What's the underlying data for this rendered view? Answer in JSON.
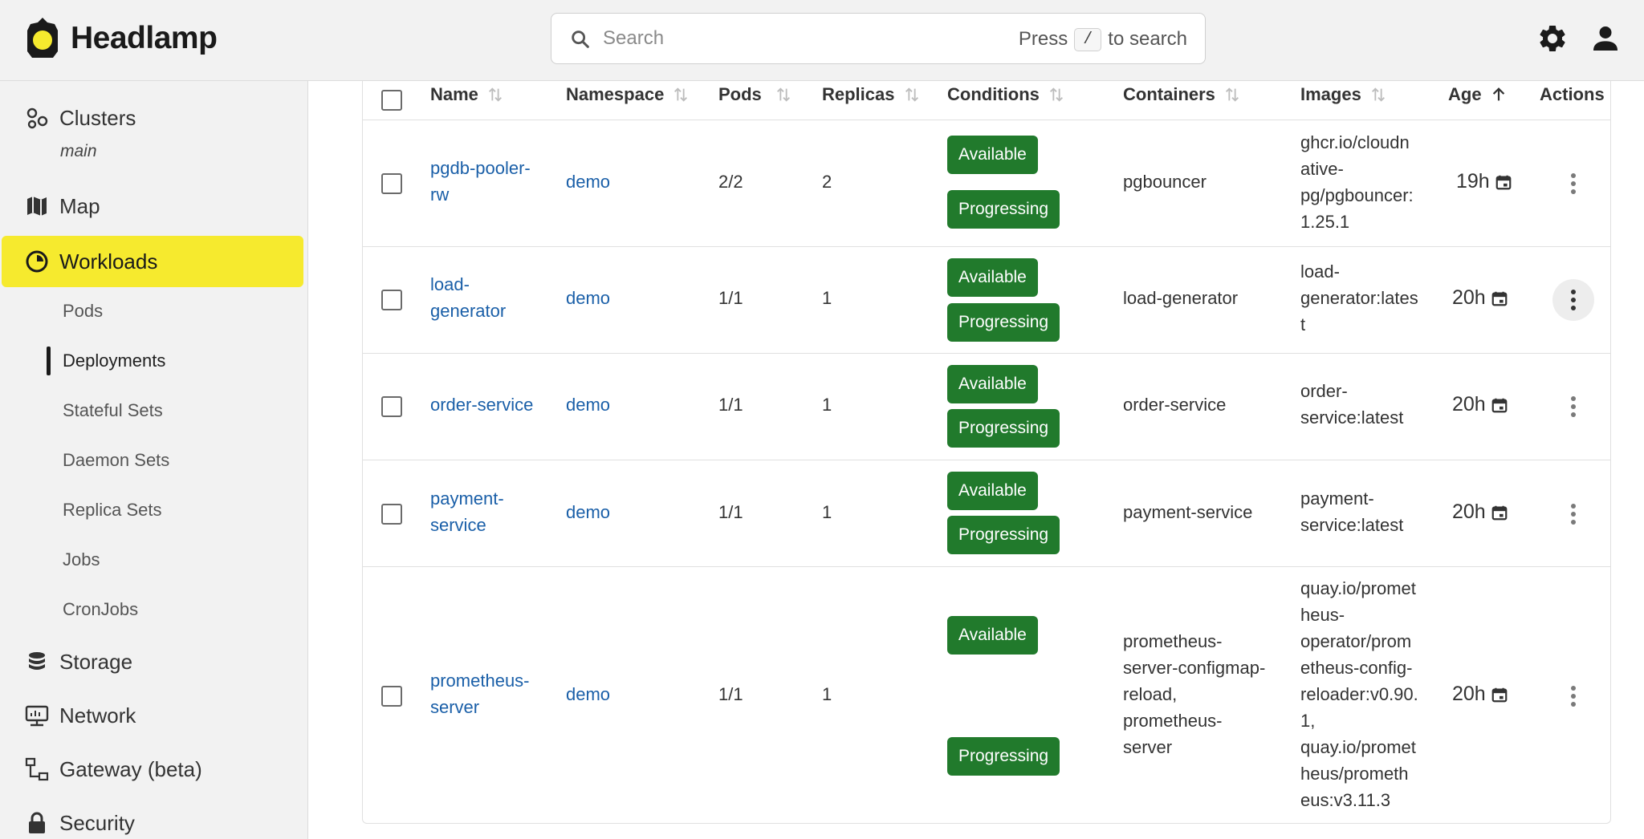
{
  "app": {
    "title": "Headlamp"
  },
  "search": {
    "placeholder": "Search",
    "hint_prefix": "Press",
    "hint_key": "/",
    "hint_suffix": "to search"
  },
  "sidebar": {
    "clusters_label": "Clusters",
    "cluster_name": "main",
    "items": [
      {
        "label": "Map",
        "icon": "map-icon"
      },
      {
        "label": "Workloads",
        "icon": "workloads-icon",
        "active": true
      },
      {
        "label": "Storage",
        "icon": "storage-icon"
      },
      {
        "label": "Network",
        "icon": "network-icon"
      },
      {
        "label": "Gateway (beta)",
        "icon": "gateway-icon"
      },
      {
        "label": "Security",
        "icon": "lock-icon"
      }
    ],
    "subitems": [
      "Pods",
      "Deployments",
      "Stateful Sets",
      "Daemon Sets",
      "Replica Sets",
      "Jobs",
      "CronJobs"
    ],
    "active_subitem": "Deployments"
  },
  "table": {
    "columns": [
      "Name",
      "Namespace",
      "Pods",
      "Replicas",
      "Conditions",
      "Containers",
      "Images",
      "Age",
      "Actions"
    ],
    "sort_column": "Age",
    "rows": [
      {
        "name": [
          "pgdb-pooler-",
          "rw"
        ],
        "namespace": "demo",
        "pods": "2/2",
        "replicas": "2",
        "conditions": [
          "Available",
          "Progressing"
        ],
        "containers": [
          "pgbouncer"
        ],
        "images": [
          "ghcr.io/cloudn",
          "ative-",
          "pg/pgbouncer:",
          "1.25.1"
        ],
        "age": "19h"
      },
      {
        "name": [
          "load-",
          "generator"
        ],
        "namespace": "demo",
        "pods": "1/1",
        "replicas": "1",
        "conditions": [
          "Available",
          "Progressing"
        ],
        "containers": [
          "load-generator"
        ],
        "images": [
          "load-",
          "generator:lates",
          "t"
        ],
        "age": "20h"
      },
      {
        "name": [
          "order-service"
        ],
        "namespace": "demo",
        "pods": "1/1",
        "replicas": "1",
        "conditions": [
          "Available",
          "Progressing"
        ],
        "containers": [
          "order-service"
        ],
        "images": [
          "order-",
          "service:latest"
        ],
        "age": "20h"
      },
      {
        "name": [
          "payment-",
          "service"
        ],
        "namespace": "demo",
        "pods": "1/1",
        "replicas": "1",
        "conditions": [
          "Available",
          "Progressing"
        ],
        "containers": [
          "payment-service"
        ],
        "images": [
          "payment-",
          "service:latest"
        ],
        "age": "20h"
      },
      {
        "name": [
          "prometheus-",
          "server"
        ],
        "namespace": "demo",
        "pods": "1/1",
        "replicas": "1",
        "conditions": [
          "Available",
          "Progressing"
        ],
        "containers": [
          "prometheus-",
          "server-configmap-",
          "reload,",
          "prometheus-",
          "server"
        ],
        "images": [
          "quay.io/promet",
          "heus-",
          "operator/prom",
          "etheus-config-",
          "reloader:v0.90.",
          "1,",
          "quay.io/promet",
          "heus/prometh",
          "eus:v3.11.3"
        ],
        "age": "20h"
      }
    ]
  },
  "colors": {
    "accent": "#f6ea2e",
    "badge": "#217a2c",
    "link": "#1a5fa8"
  }
}
